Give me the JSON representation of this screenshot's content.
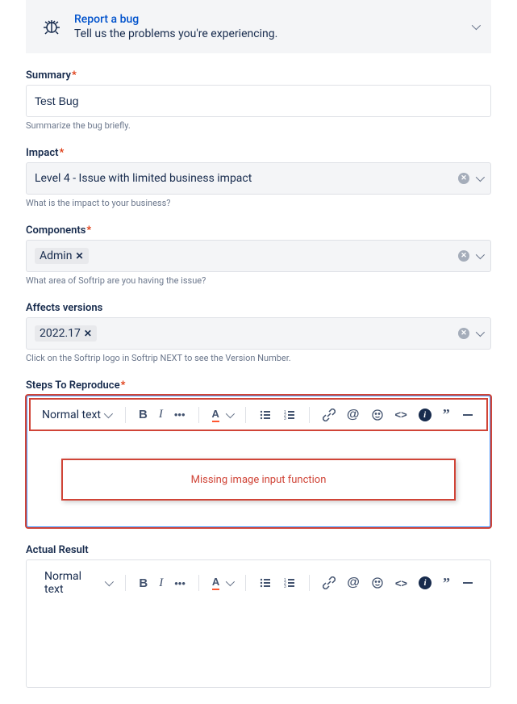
{
  "banner": {
    "title": "Report a bug",
    "subtitle": "Tell us the problems you're experiencing."
  },
  "summary": {
    "label": "Summary",
    "value": "Test Bug",
    "help": "Summarize the bug briefly."
  },
  "impact": {
    "label": "Impact",
    "value": "Level 4 - Issue with limited business impact",
    "help": "What is the impact to your business?"
  },
  "components": {
    "label": "Components",
    "tag": "Admin",
    "help": "What area of Softrip are you having the issue?"
  },
  "affects": {
    "label": "Affects versions",
    "tag": "2022.17",
    "help": "Click on the Softrip logo in Softrip NEXT to see the Version Number."
  },
  "steps": {
    "label": "Steps To Reproduce",
    "annotation": "Missing image input function"
  },
  "actual": {
    "label": "Actual Result"
  },
  "toolbar": {
    "textStyle": "Normal text"
  }
}
